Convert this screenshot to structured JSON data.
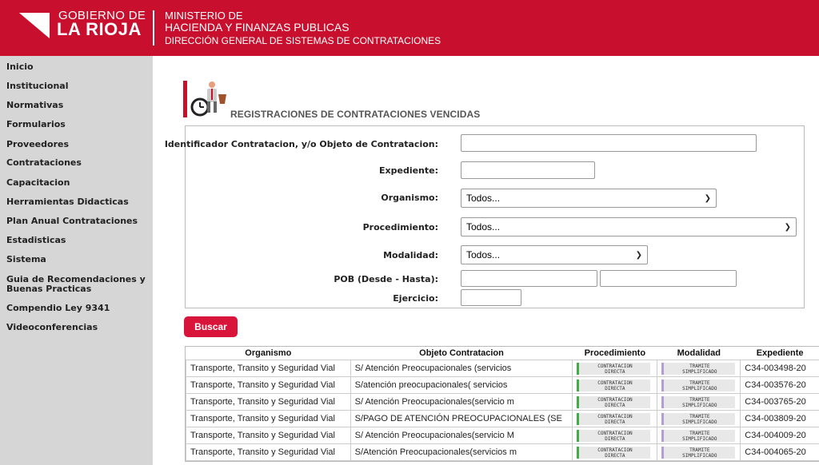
{
  "header": {
    "gov_line1": "GOBIERNO DE",
    "gov_line2": "LA RIOJA",
    "ministry_line1": "MINISTERIO DE",
    "ministry_line2": "HACIENDA Y FINANZAS PUBLICAS",
    "ministry_line3": "DIRECCIÓN GENERAL DE SISTEMAS DE CONTRATACIONES",
    "bg_color": "#c8102e"
  },
  "sidebar": {
    "items": [
      {
        "label": "Inicio"
      },
      {
        "label": "Institucional"
      },
      {
        "label": "Normativas"
      },
      {
        "label": "Formularios"
      },
      {
        "label": "Proveedores"
      },
      {
        "label": "Contrataciones"
      },
      {
        "label": "Capacitacion"
      },
      {
        "label": "Herramientas Didacticas"
      },
      {
        "label": "Plan Anual Contrataciones"
      },
      {
        "label": "Estadisticas"
      },
      {
        "label": "Sistema"
      },
      {
        "label": "Guia de Recomendaciones y Buenas Practicas"
      },
      {
        "label": "Compendio Ley 9341"
      },
      {
        "label": "Videoconferencias"
      }
    ]
  },
  "page": {
    "title": "REGISTRACIONES DE CONTRATACIONES VENCIDAS",
    "title_icon": "clock-person-icon"
  },
  "form": {
    "identificador_label": "Identificador Contratacion, y/o Objeto de Contratacion:",
    "identificador_value": "",
    "expediente_label": "Expediente:",
    "expediente_value": "",
    "organismo_label": "Organismo:",
    "organismo_value": "Todos...",
    "procedimiento_label": "Procedimiento:",
    "procedimiento_value": "Todos...",
    "modalidad_label": "Modalidad:",
    "modalidad_value": "Todos...",
    "pob_label": "POB (Desde - Hasta):",
    "pob_desde_value": "",
    "pob_hasta_value": "",
    "ejercicio_label": "Ejercicio:",
    "ejercicio_value": "",
    "search_button": "Buscar"
  },
  "table": {
    "headers": [
      "Organismo",
      "Objeto Contratacion",
      "Procedimiento",
      "Modalidad",
      "Expediente"
    ],
    "rows": [
      {
        "organismo": "Transporte, Transito y Seguridad Vial",
        "objeto": "S/ Atención Preocupacionales (servicios",
        "proc_l1": "CONTRATACION",
        "proc_l2": "DIRECTA",
        "mod_l1": "TRAMITE",
        "mod_l2": "SIMPLIFICADO",
        "expediente": "C34-003498-20"
      },
      {
        "organismo": "Transporte, Transito y Seguridad Vial",
        "objeto": "S/atención preocupacionales( servicios",
        "proc_l1": "CONTRATACION",
        "proc_l2": "DIRECTA",
        "mod_l1": "TRAMITE",
        "mod_l2": "SIMPLIFICADO",
        "expediente": "C34-003576-20"
      },
      {
        "organismo": "Transporte, Transito y Seguridad Vial",
        "objeto": "S/ Atención Preocupacionales(servicio m",
        "proc_l1": "CONTRATACION",
        "proc_l2": "DIRECTA",
        "mod_l1": "TRAMITE",
        "mod_l2": "SIMPLIFICADO",
        "expediente": "C34-003765-20"
      },
      {
        "organismo": "Transporte, Transito y Seguridad Vial",
        "objeto": "S/PAGO DE ATENCIÓN PREOCUPACIONALES (SE",
        "proc_l1": "CONTRATACION",
        "proc_l2": "DIRECTA",
        "mod_l1": "TRAMITE",
        "mod_l2": "SIMPLIFICADO",
        "expediente": "C34-003809-20"
      },
      {
        "organismo": "Transporte, Transito y Seguridad Vial",
        "objeto": "S/ Atención Preocupacionales(servicio M",
        "proc_l1": "CONTRATACION",
        "proc_l2": "DIRECTA",
        "mod_l1": "TRAMITE",
        "mod_l2": "SIMPLIFICADO",
        "expediente": "C34-004009-20"
      },
      {
        "organismo": "Transporte, Transito y Seguridad Vial",
        "objeto": "S/Atención Preocupacionales(servicios m",
        "proc_l1": "CONTRATACION",
        "proc_l2": "DIRECTA",
        "mod_l1": "TRAMITE",
        "mod_l2": "SIMPLIFICADO",
        "expediente": "C34-004065-20"
      }
    ]
  },
  "colors": {
    "accent": "#c8102e",
    "button": "#d9143a",
    "procedimiento_badge": "#3cb043",
    "modalidad_badge": "#b79ad8"
  }
}
